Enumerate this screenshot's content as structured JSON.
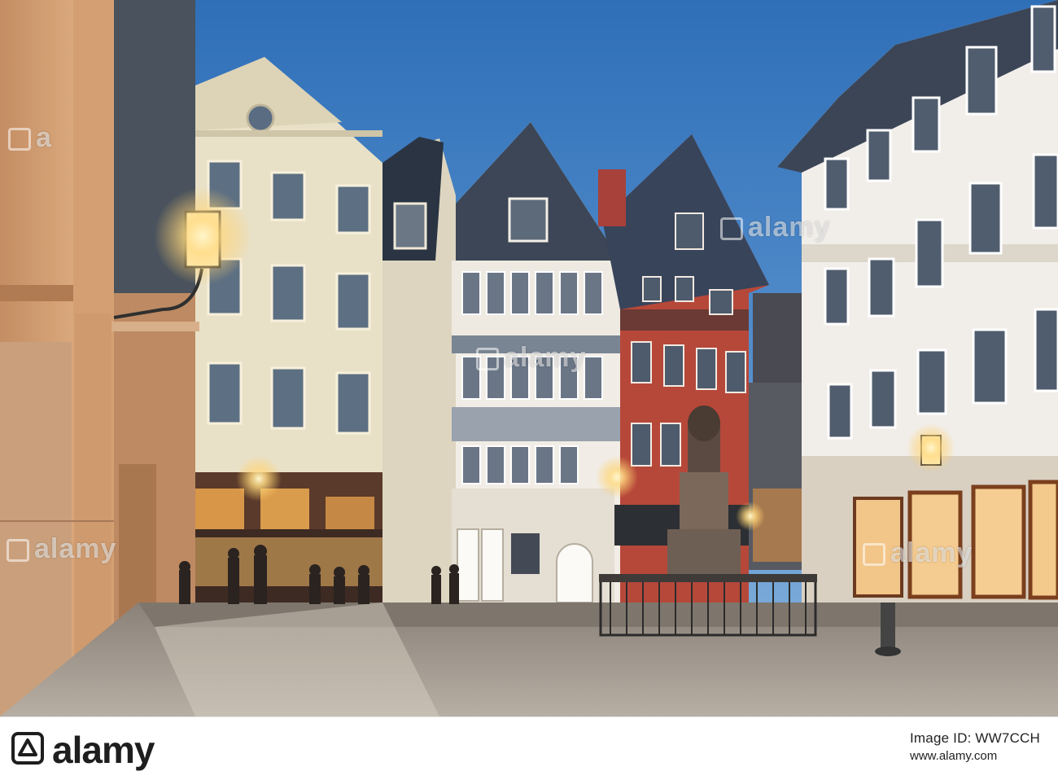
{
  "photo": {
    "watermark_text": "alamy"
  },
  "footer": {
    "logo_text": "alamy",
    "image_id_label": "Image ID: WW7CCH",
    "site_url": "www.alamy.com"
  }
}
